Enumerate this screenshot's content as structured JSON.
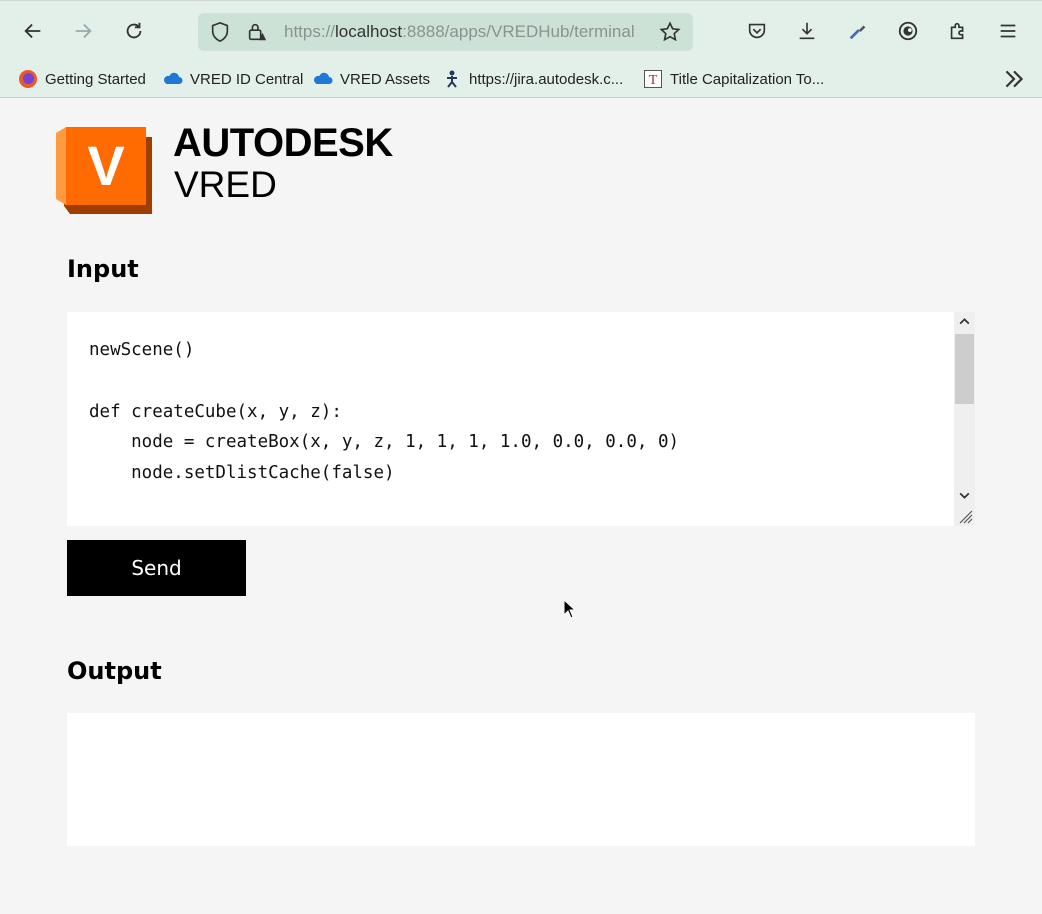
{
  "browser": {
    "url_prefix": "https://",
    "url_host": "localhost",
    "url_rest": ":8888/apps/VREDHub/terminal",
    "bookmarks": [
      {
        "label": "Getting Started",
        "icon": "firefox-icon"
      },
      {
        "label": "VRED ID Central",
        "icon": "cloud-icon"
      },
      {
        "label": "VRED Assets",
        "icon": "cloud-icon"
      },
      {
        "label": "https://jira.autodesk.c...",
        "icon": "jira-icon"
      },
      {
        "label": "Title Capitalization To...",
        "icon": "title-t-icon"
      }
    ]
  },
  "brand": {
    "logo_letter": "V",
    "line1": "AUTODESK",
    "line2": "VRED",
    "colors": {
      "orange": "#ff6b00",
      "light_orange": "#ff9a40",
      "dark_orange": "#9e3f00"
    }
  },
  "input": {
    "heading": "Input",
    "code": "newScene()\n\ndef createCube(x, y, z):\n    node = createBox(x, y, z, 1, 1, 1, 1.0, 0.0, 0.0, 0)\n    node.setDlistCache(false)\n\n    updateScene()"
  },
  "send_label": "Send",
  "output": {
    "heading": "Output",
    "text": ""
  }
}
